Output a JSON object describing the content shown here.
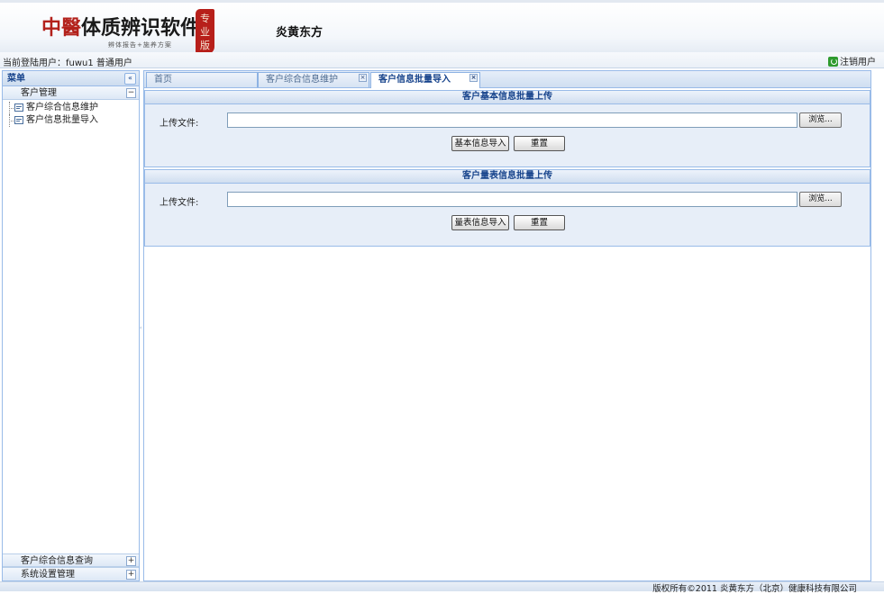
{
  "header": {
    "logo_text_a": "中醫",
    "logo_text_b": "体质辨识软件",
    "logo_tagline": "辨体报告+施养方案",
    "logo_seal": "专业版",
    "company": "炎黄东方"
  },
  "userbar": {
    "current_user": "当前登陆用户：fuwu1  普通用户",
    "logout_label": "注销用户"
  },
  "sidebar": {
    "title": "菜单",
    "groups": [
      {
        "label": "客户管理",
        "expanded": true,
        "items": [
          {
            "label": "客户综合信息维护"
          },
          {
            "label": "客户信息批量导入"
          }
        ]
      },
      {
        "label": "客户综合信息查询",
        "expanded": false
      },
      {
        "label": "系统设置管理",
        "expanded": false
      }
    ]
  },
  "tabs": [
    {
      "label": "首页",
      "closable": false,
      "active": false
    },
    {
      "label": "客户综合信息维护",
      "closable": true,
      "active": false
    },
    {
      "label": "客户信息批量导入",
      "closable": true,
      "active": true
    }
  ],
  "panels": [
    {
      "title": "客户基本信息批量上传",
      "file_label": "上传文件:",
      "file_value": "",
      "browse_label": "浏览...",
      "import_label": "基本信息导入",
      "reset_label": "重置"
    },
    {
      "title": "客户量表信息批量上传",
      "file_label": "上传文件:",
      "file_value": "",
      "browse_label": "浏览...",
      "import_label": "量表信息导入",
      "reset_label": "重置"
    }
  ],
  "footer": {
    "copyright": "版权所有©2011 炎黄东方（北京）健康科技有限公司"
  },
  "colors": {
    "accent": "#15428b",
    "border": "#99bbe8",
    "seal_red": "#b71f1a"
  }
}
